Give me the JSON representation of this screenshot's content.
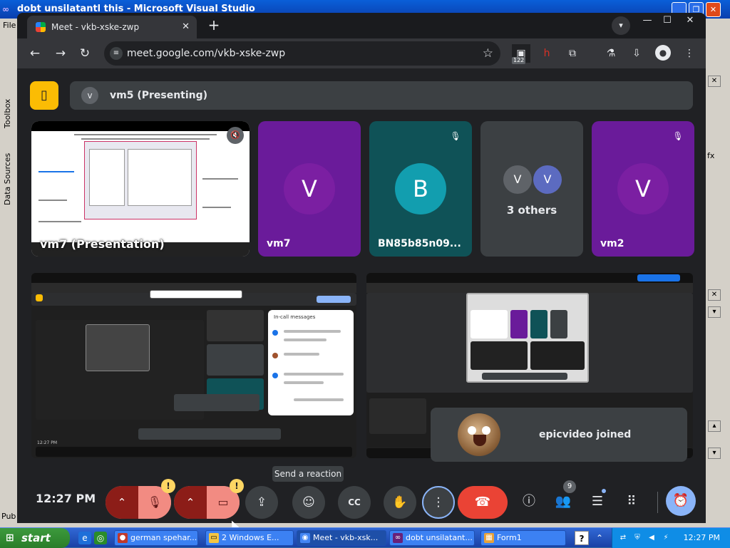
{
  "vs": {
    "title": "dobt unsilatantl this - Microsoft Visual Studio",
    "menu": "File",
    "toolbox_tab": "Toolbox",
    "datasources_tab": "Data Sources",
    "public_text": "Pub",
    "right_text": "fx"
  },
  "browser": {
    "tab_title": "Meet - vkb-xske-zwp",
    "url": "meet.google.com/vkb-xske-zwp",
    "ext_badge": "122"
  },
  "meet": {
    "presenting_initial": "v",
    "presenting_label": "vm5 (Presenting)",
    "tiles": [
      {
        "name": "vm7 (Presentation)"
      },
      {
        "name": "vm7",
        "initial": "V"
      },
      {
        "name": "BN85b85n09...",
        "initial": "B"
      },
      {
        "others_label": "3 others",
        "initials": [
          "V",
          "V"
        ]
      },
      {
        "name": "vm2",
        "initial": "V"
      }
    ],
    "joined_text": "epicvideo joined",
    "tooltip": "Send a reaction",
    "clock": "12:27 PM",
    "people_count": "9",
    "mini": {
      "chat_title": "In-call messages",
      "time": "12:27 PM"
    }
  },
  "taskbar": {
    "start": "start",
    "items": [
      {
        "label": "german spehar..."
      },
      {
        "label": "2 Windows E..."
      },
      {
        "label": "Meet - vkb-xsk..."
      },
      {
        "label": "dobt unsilatant..."
      },
      {
        "label": "Form1"
      }
    ],
    "time": "12:27 PM"
  }
}
